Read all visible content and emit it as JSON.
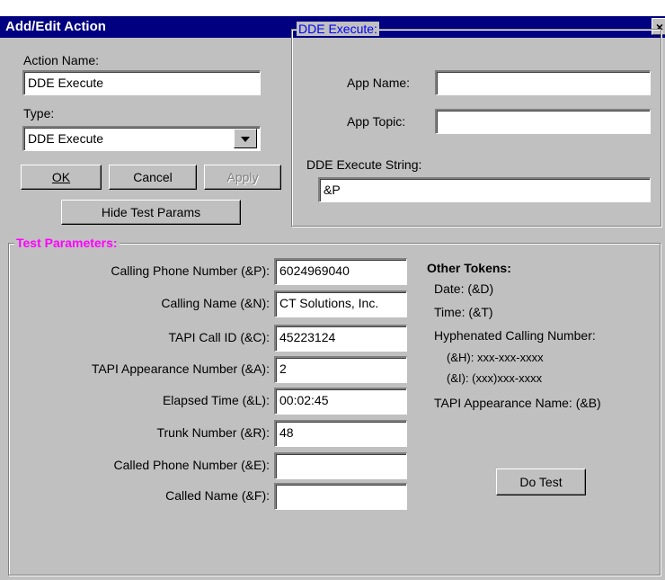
{
  "window": {
    "title": "Add/Edit Action",
    "close_label": "×"
  },
  "action": {
    "name_label": "Action Name:",
    "name_value": "DDE Execute",
    "type_label": "Type:",
    "type_value": "DDE Execute"
  },
  "buttons": {
    "ok": "OK",
    "cancel": "Cancel",
    "apply": "Apply",
    "hide_test_params": "Hide Test Params",
    "do_test": "Do Test"
  },
  "dde": {
    "group_title": "DDE Execute:",
    "app_name_label": "App Name:",
    "app_name_value": "",
    "app_topic_label": "App Topic:",
    "app_topic_value": "",
    "exec_string_label": "DDE Execute String:",
    "exec_string_value": "&P"
  },
  "test_params": {
    "group_title": "Test Parameters:",
    "rows": [
      {
        "label": "Calling Phone Number (&P):",
        "value": "6024969040"
      },
      {
        "label": "Calling Name (&N):",
        "value": "CT Solutions, Inc."
      },
      {
        "label": "TAPI Call ID (&C):",
        "value": "45223124"
      },
      {
        "label": "TAPI Appearance Number (&A):",
        "value": "2"
      },
      {
        "label": "Elapsed Time (&L):",
        "value": "00:02:45"
      },
      {
        "label": "Trunk Number (&R):",
        "value": "48"
      },
      {
        "label": "Called Phone Number (&E):",
        "value": ""
      },
      {
        "label": "Called Name (&F):",
        "value": ""
      }
    ]
  },
  "other_tokens": {
    "title": "Other Tokens:",
    "date": "Date: (&D)",
    "time": "Time: (&T)",
    "hyphenated": "Hyphenated Calling Number:",
    "h_token": "(&H): xxx-xxx-xxxx",
    "i_token": "(&I): (xxx)xxx-xxxx",
    "appearance_name": "TAPI Appearance Name: (&B)"
  },
  "colors": {
    "titlebar": "#000080",
    "dde_legend": "#0000ff",
    "test_legend": "#ff00ff"
  }
}
